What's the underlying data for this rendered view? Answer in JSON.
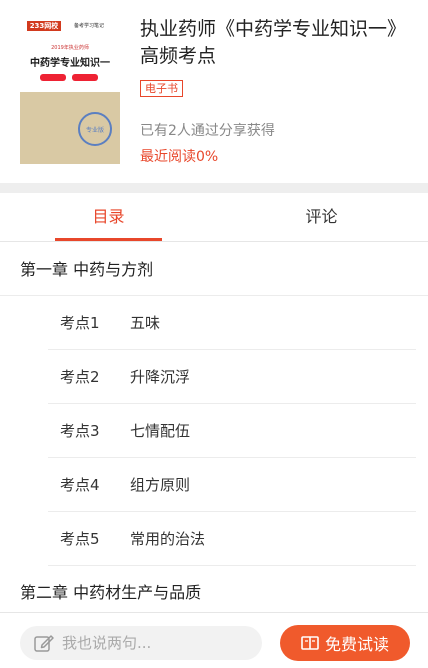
{
  "book": {
    "cover": {
      "logo": "233网校",
      "tag": "备考学习笔记",
      "year_line": "2019年执业药师",
      "title": "中药学专业知识一",
      "stamp": "专业版"
    },
    "title": "执业药师《中药学专业知识一》高频考点",
    "badge": "电子书",
    "share_text": "已有2人通过分享获得",
    "read_progress": "最近阅读0%"
  },
  "tabs": [
    {
      "label": "目录",
      "active": true
    },
    {
      "label": "评论",
      "active": false
    }
  ],
  "toc": {
    "chapter1": "第一章 中药与方剂",
    "points": [
      {
        "num": "考点1",
        "title": "五味"
      },
      {
        "num": "考点2",
        "title": "升降沉浮"
      },
      {
        "num": "考点3",
        "title": "七情配伍"
      },
      {
        "num": "考点4",
        "title": "组方原则"
      },
      {
        "num": "考点5",
        "title": "常用的治法"
      }
    ],
    "chapter2": "第二章 中药材生产与品质"
  },
  "bottom": {
    "comment_placeholder": "我也说两句...",
    "trial_label": "免费试读"
  },
  "colors": {
    "accent": "#e8472b",
    "button": "#f05a2c"
  },
  "icons": {
    "comment": "edit-icon",
    "trial": "book-open-icon"
  }
}
